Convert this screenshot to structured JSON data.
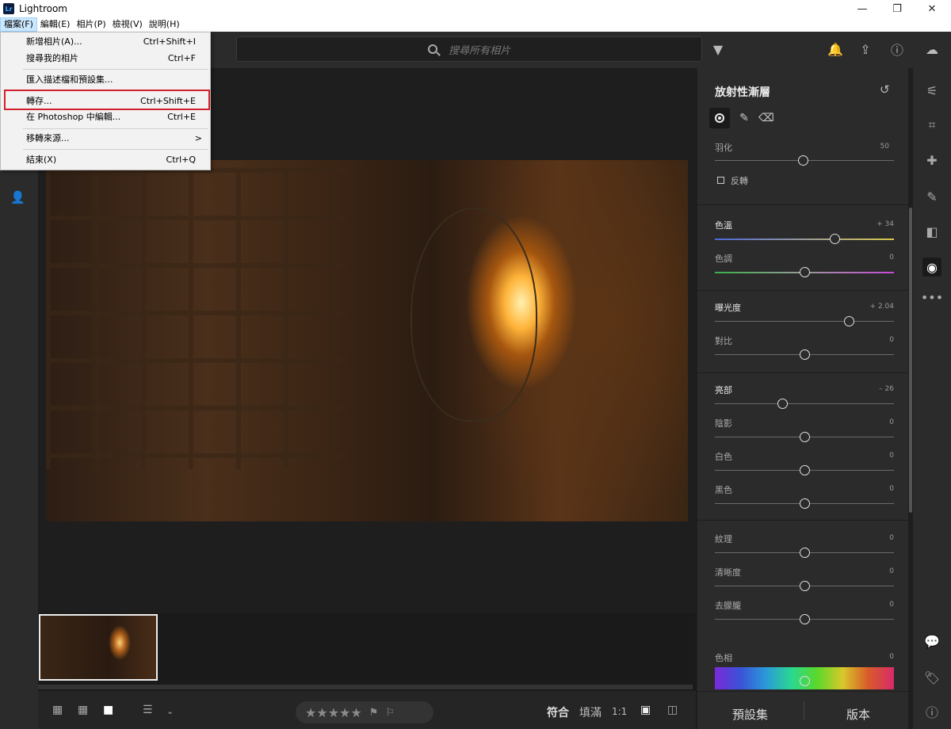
{
  "window": {
    "title": "Lightroom",
    "logo": "Lr"
  },
  "menubar": [
    "檔案(F)",
    "編輯(E)",
    "相片(P)",
    "檢視(V)",
    "說明(H)"
  ],
  "file_menu": {
    "items": [
      {
        "label": "新增相片(A)...",
        "shortcut": "Ctrl+Shift+I"
      },
      {
        "label": "搜尋我的相片",
        "shortcut": "Ctrl+F"
      },
      {
        "label": "匯入描述檔和預設集..."
      },
      {
        "label": "轉存...",
        "shortcut": "Ctrl+Shift+E",
        "highlighted": true
      },
      {
        "label": "在 Photoshop 中編輯...",
        "shortcut": "Ctrl+E"
      },
      {
        "label": "移轉來源...",
        "shortcut": ">"
      },
      {
        "label": "結束(X)",
        "shortcut": "Ctrl+Q"
      }
    ]
  },
  "search": {
    "placeholder": "搜尋所有相片"
  },
  "panel": {
    "title": "放射性漸層",
    "feather": {
      "label": "羽化",
      "value": "50",
      "pos": 0.5
    },
    "invert_label": "反轉",
    "sliders": [
      {
        "label": "色溫",
        "value": "+ 34",
        "pos": 0.67
      },
      {
        "label": "色調",
        "value": "0",
        "pos": 0.5
      },
      {
        "label": "曝光度",
        "value": "+ 2.04",
        "pos": 0.75
      },
      {
        "label": "對比",
        "value": "0",
        "pos": 0.5
      },
      {
        "label": "亮部",
        "value": "– 26",
        "pos": 0.38
      },
      {
        "label": "陰影",
        "value": "0",
        "pos": 0.5
      },
      {
        "label": "白色",
        "value": "0",
        "pos": 0.5
      },
      {
        "label": "黑色",
        "value": "0",
        "pos": 0.5
      },
      {
        "label": "紋理",
        "value": "0",
        "pos": 0.5
      },
      {
        "label": "清晰度",
        "value": "0",
        "pos": 0.5
      },
      {
        "label": "去朦朧",
        "value": "0",
        "pos": 0.5
      }
    ],
    "hue": {
      "label": "色相",
      "value": "0"
    }
  },
  "rp_bottom": {
    "presets": "預設集",
    "versions": "版本"
  },
  "zoom": {
    "fit": "符合",
    "fill": "填滿",
    "one": "1:1"
  },
  "stars": "★★★★★"
}
